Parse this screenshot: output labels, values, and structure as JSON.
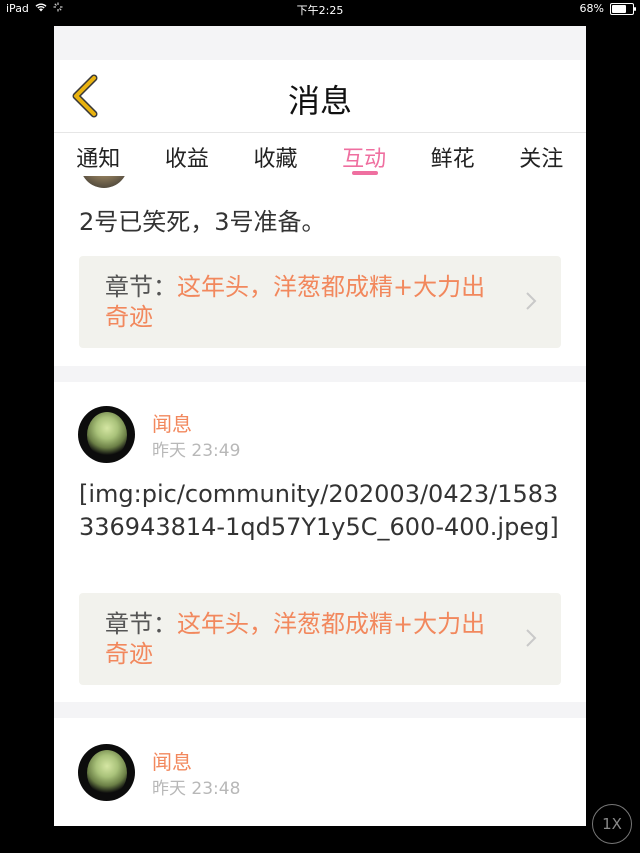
{
  "status_bar": {
    "device": "iPad",
    "time": "下午2:25",
    "battery": "68%",
    "battery_level": 0.68
  },
  "nav": {
    "title": "消息"
  },
  "tabs": [
    {
      "label": "通知",
      "active": false
    },
    {
      "label": "收益",
      "active": false
    },
    {
      "label": "收藏",
      "active": false
    },
    {
      "label": "互动",
      "active": true
    },
    {
      "label": "鲜花",
      "active": false
    },
    {
      "label": "关注",
      "active": false
    }
  ],
  "posts": [
    {
      "text": "2号已笑死，3号准备。",
      "chapter_prefix": "章节：",
      "chapter_title": "这年头，洋葱都成精+大力出奇迹"
    },
    {
      "user": "闻息",
      "time": "昨天 23:49",
      "text": "[img:pic/community/202003/0423/1583336943814-1qd57Y1y5C_600-400.jpeg]",
      "chapter_prefix": "章节：",
      "chapter_title": "这年头，洋葱都成精+大力出奇迹"
    },
    {
      "user": "闻息",
      "time": "昨天 23:48"
    }
  ],
  "zoom_button": "1X",
  "colors": {
    "accent_pink": "#ef6fa0",
    "accent_orange": "#f2885d",
    "back_arrow": "#e9b20f"
  }
}
